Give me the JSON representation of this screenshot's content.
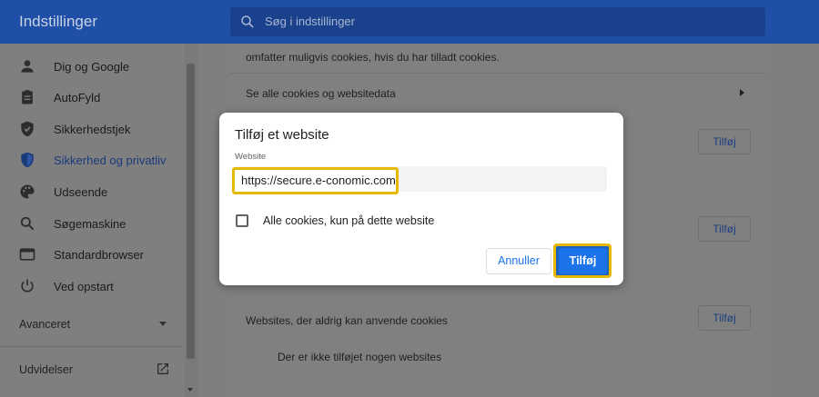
{
  "header": {
    "title": "Indstillinger",
    "search_placeholder": "Søg i indstillinger"
  },
  "sidebar": {
    "items": [
      {
        "label": "Dig og Google",
        "icon": "person-icon"
      },
      {
        "label": "AutoFyld",
        "icon": "clipboard-icon"
      },
      {
        "label": "Sikkerhedstjek",
        "icon": "shield-check-icon"
      },
      {
        "label": "Sikkerhed og privatliv",
        "icon": "shield-icon",
        "active": true
      },
      {
        "label": "Udseende",
        "icon": "palette-icon"
      },
      {
        "label": "Søgemaskine",
        "icon": "search-icon"
      },
      {
        "label": "Standardbrowser",
        "icon": "browser-icon"
      },
      {
        "label": "Ved opstart",
        "icon": "power-icon"
      }
    ],
    "advanced_label": "Avanceret",
    "extensions_label": "Udvidelser"
  },
  "main": {
    "top_text": "omfatter muligvis cookies, hvis du har tilladt cookies.",
    "see_all_cookies": "Se alle cookies og websitedata",
    "add_button_label": "Tilføj",
    "never_cookies_heading": "Websites, der aldrig kan anvende cookies",
    "no_sites_text": "Der er ikke tilføjet nogen websites"
  },
  "dialog": {
    "title": "Tilføj et website",
    "field_label": "Website",
    "field_value": "https://secure.e-conomic.com",
    "checkbox_label": "Alle cookies, kun på dette website",
    "checkbox_checked": false,
    "cancel_label": "Annuller",
    "add_label": "Tilføj"
  },
  "colors": {
    "header_bg": "#1f4fa6",
    "accent": "#1a73e8",
    "highlight": "#e6b800",
    "overlay_bg": "#7f7f7f"
  }
}
